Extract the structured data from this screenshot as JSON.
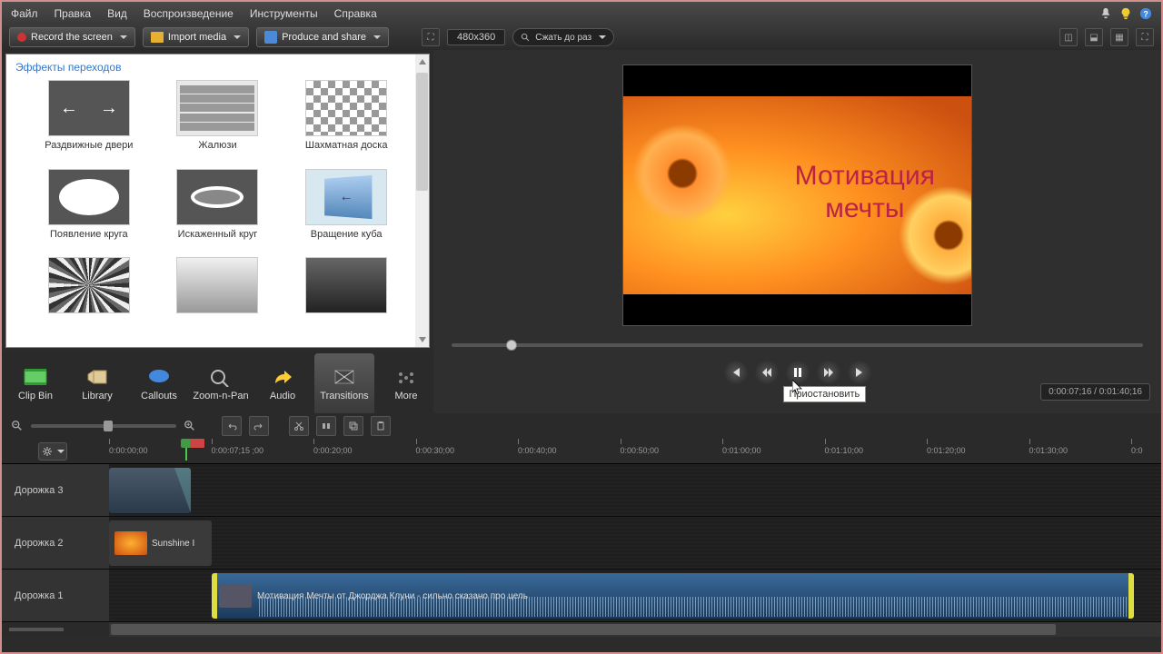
{
  "menu": {
    "items": [
      "Файл",
      "Правка",
      "Вид",
      "Воспроизведение",
      "Инструменты",
      "Справка"
    ]
  },
  "toolbar": {
    "record": "Record the screen",
    "import": "Import media",
    "produce": "Produce and share",
    "dimensions": "480x360",
    "zoom_fit": "Сжать до раз"
  },
  "transitions": {
    "title": "Эффекты переходов",
    "items": [
      {
        "label": "Раздвижные двери",
        "thumb": "sliding"
      },
      {
        "label": "Жалюзи",
        "thumb": "blinds"
      },
      {
        "label": "Шахматная доска",
        "thumb": "checker"
      },
      {
        "label": "Появление круга",
        "thumb": "circle"
      },
      {
        "label": "Искаженный круг",
        "thumb": "stretch"
      },
      {
        "label": "Вращение куба",
        "thumb": "cube"
      },
      {
        "label": "",
        "thumb": "noise"
      },
      {
        "label": "",
        "thumb": "grad1"
      },
      {
        "label": "",
        "thumb": "grad2"
      }
    ]
  },
  "tabs": {
    "items": [
      "Clip Bin",
      "Library",
      "Callouts",
      "Zoom-n-Pan",
      "Audio",
      "Transitions",
      "More"
    ],
    "active": 5
  },
  "preview": {
    "text_line1": "Мотивация",
    "text_line2": "мечты",
    "tooltip": "Приостановить",
    "time": "0:00:07;16 / 0:01:40;16"
  },
  "ruler": {
    "marks": [
      "0:00:00;00",
      "0:00:07;15   ;00",
      "0:00:20;00",
      "0:00:30;00",
      "0:00:40;00",
      "0:00:50;00",
      "0:01:00;00",
      "0:01:10;00",
      "0:01:20;00",
      "0:01:30;00",
      "0:0"
    ]
  },
  "tracks": {
    "t3": "Дорожка 3",
    "t2": "Дорожка 2",
    "t1": "Дорожка 1",
    "clip2_name": "Sunshine I",
    "clip1_name": "Мотивация Мечты от Джорджа Клуни - сильно сказано про цель"
  }
}
